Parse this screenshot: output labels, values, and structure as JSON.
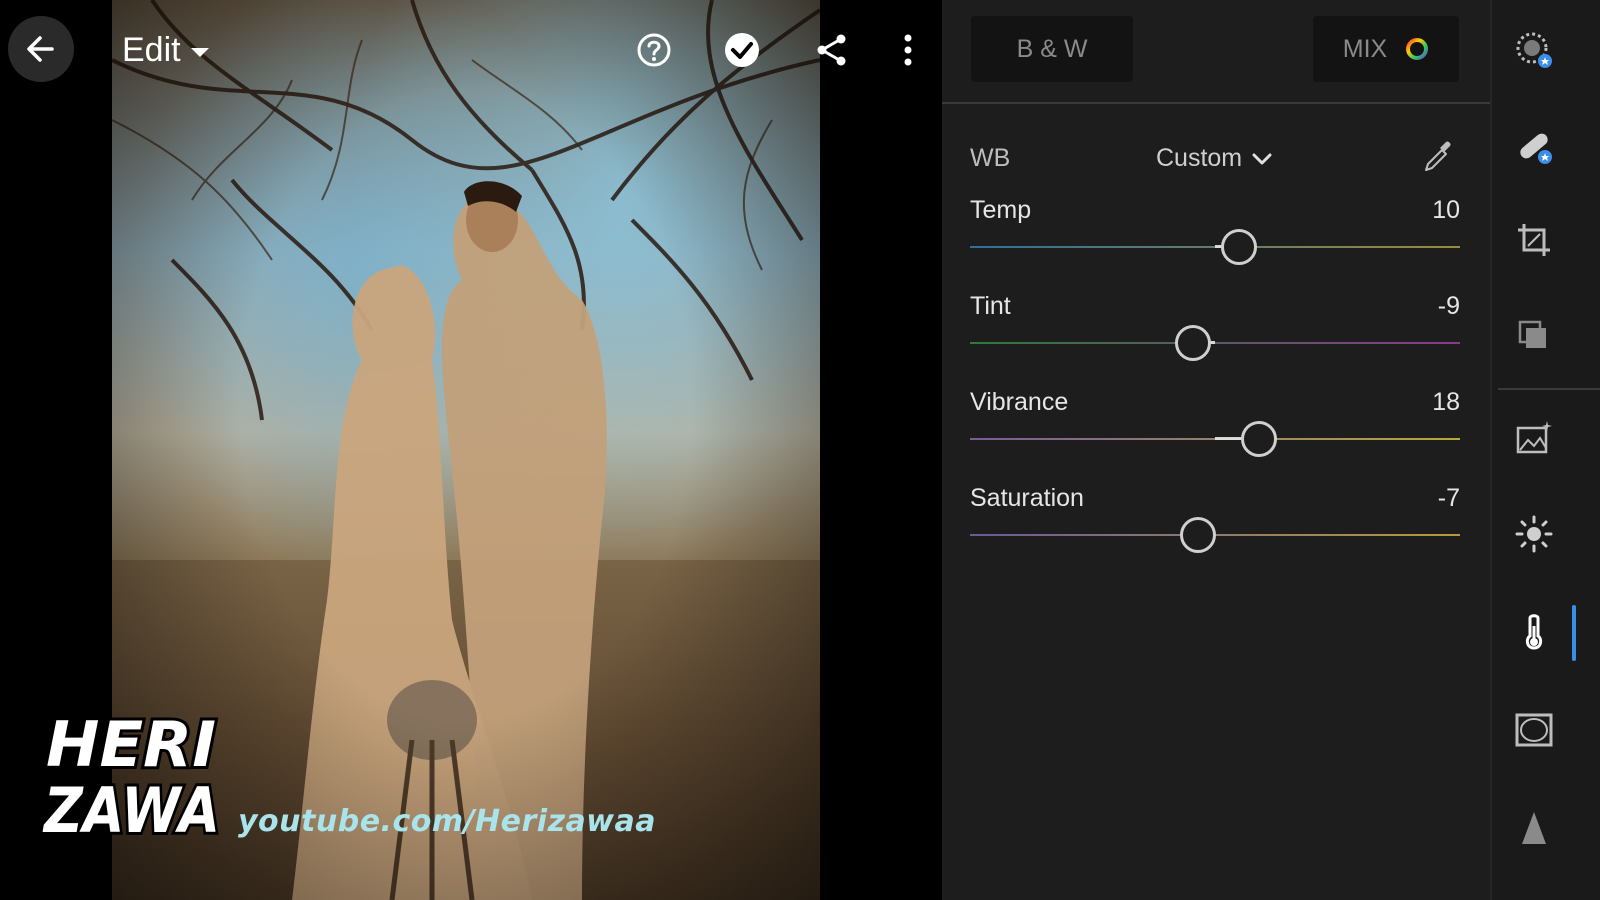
{
  "topbar": {
    "edit_label": "Edit",
    "back_icon": "arrow-left-icon",
    "help_icon": "help-circle-icon",
    "done_icon": "check-circle-icon",
    "share_icon": "share-icon",
    "more_icon": "more-vertical-icon"
  },
  "watermark": {
    "logo_line1": "HERI",
    "logo_line2": "ZAWA",
    "url": "youtube.com/Herizawaa"
  },
  "panel": {
    "tabs": [
      {
        "label": "B & W"
      },
      {
        "label": "MIX"
      }
    ],
    "wb": {
      "label": "WB",
      "value": "Custom"
    },
    "sliders": [
      {
        "name": "Temp",
        "value": "10",
        "position": 0.548,
        "gradient": [
          "#2f6f9a",
          "#9a8a3a"
        ]
      },
      {
        "name": "Tint",
        "value": "-9",
        "position": 0.455,
        "gradient": [
          "#2e7a3a",
          "#8b3a8f"
        ]
      },
      {
        "name": "Vibrance",
        "value": "18",
        "position": 0.59,
        "gradient": [
          "#7a5a9a",
          "#b8a83a"
        ]
      },
      {
        "name": "Saturation",
        "value": "-7",
        "position": 0.465,
        "gradient": [
          "#6a5a9a",
          "#b89a3a"
        ]
      }
    ]
  },
  "rail": {
    "items": [
      {
        "icon": "selective-mask-icon"
      },
      {
        "icon": "healing-bandage-icon"
      },
      {
        "icon": "crop-icon"
      },
      {
        "icon": "presets-icon"
      },
      {
        "icon": "auto-enhance-icon"
      },
      {
        "icon": "light-sun-icon"
      },
      {
        "icon": "color-thermometer-icon"
      },
      {
        "icon": "vignette-effects-icon"
      },
      {
        "icon": "detail-triangle-icon"
      }
    ]
  },
  "colors": {
    "panel_bg": "#1d1d1d",
    "accent_blue": "#3b8ee8",
    "watermark_url": "#a9e4ec"
  }
}
